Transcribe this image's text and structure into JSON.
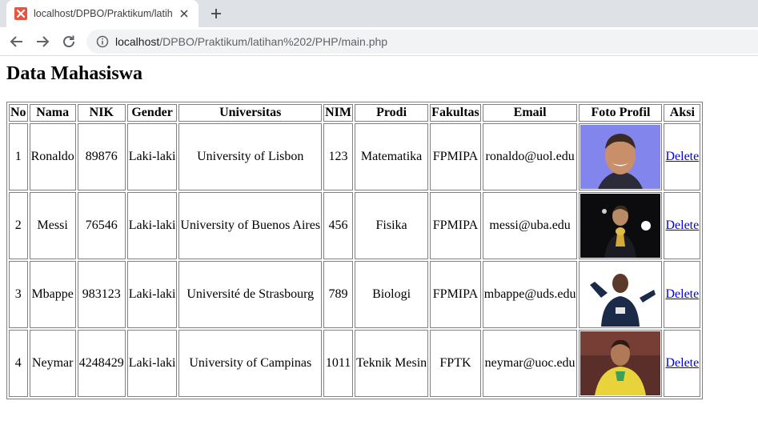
{
  "browser": {
    "tab_title": "localhost/DPBO/Praktikum/latiha",
    "url_host": "localhost",
    "url_path": "/DPBO/Praktikum/latihan%202/PHP/main.php"
  },
  "page": {
    "title": "Data Mahasiswa"
  },
  "table": {
    "headers": [
      "No",
      "Nama",
      "NIK",
      "Gender",
      "Universitas",
      "NIM",
      "Prodi",
      "Fakultas",
      "Email",
      "Foto Profil",
      "Aksi"
    ],
    "rows": [
      {
        "no": "1",
        "nama": "Ronaldo",
        "nik": "89876",
        "gender": "Laki-laki",
        "universitas": "University of Lisbon",
        "nim": "123",
        "prodi": "Matematika",
        "fakultas": "FPMIPA",
        "email": "ronaldo@uol.edu",
        "aksi": "Delete"
      },
      {
        "no": "2",
        "nama": "Messi",
        "nik": "76546",
        "gender": "Laki-laki",
        "universitas": "University of Buenos Aires",
        "nim": "456",
        "prodi": "Fisika",
        "fakultas": "FPMIPA",
        "email": "messi@uba.edu",
        "aksi": "Delete"
      },
      {
        "no": "3",
        "nama": "Mbappe",
        "nik": "983123",
        "gender": "Laki-laki",
        "universitas": "Université de Strasbourg",
        "nim": "789",
        "prodi": "Biologi",
        "fakultas": "FPMIPA",
        "email": "mbappe@uds.edu",
        "aksi": "Delete"
      },
      {
        "no": "4",
        "nama": "Neymar",
        "nik": "4248429",
        "gender": "Laki-laki",
        "universitas": "University of Campinas",
        "nim": "1011",
        "prodi": "Teknik Mesin",
        "fakultas": "FPTK",
        "email": "neymar@uoc.edu",
        "aksi": "Delete"
      }
    ]
  }
}
